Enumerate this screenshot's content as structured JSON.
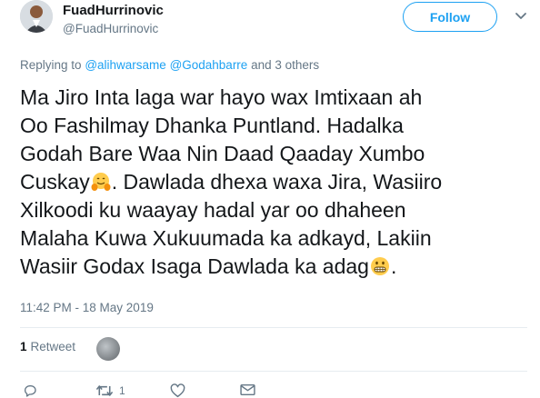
{
  "user": {
    "display_name": "FuadHurrinovic",
    "handle": "@FuadHurrinovic"
  },
  "follow_label": "Follow",
  "replying": {
    "prefix": "Replying to",
    "mention1": "@alihwarsame",
    "mention2": "@Godahbarre",
    "suffix": "and 3 others"
  },
  "tweet": {
    "line1": "Ma Jiro Inta laga war hayo wax Imtixaan ah",
    "line2": "Oo Fashilmay Dhanka Puntland. Hadalka",
    "line3": "Godah Bare Waa Nin Daad Qaaday Xumbo",
    "line4a": "Cuskay",
    "line4b": ". Dawlada dhexa waxa Jira, Wasiiro",
    "line5": "Xilkoodi ku waayay hadal yar oo dhaheen",
    "line6": "Malaha Kuwa Xukuumada ka adkayd, Lakiin",
    "line7a": "Wasiir Godax Isaga Dawlada ka adag",
    "line7b": ".",
    "emoji1": "hugging-face",
    "emoji2": "grimacing-face"
  },
  "timestamp": "11:42 PM - 18 May 2019",
  "stats": {
    "retweet_count": "1",
    "retweet_label": "Retweet"
  },
  "actions": {
    "reply_icon": "reply-icon",
    "retweet_icon": "retweet-icon",
    "retweet_count": "1",
    "like_icon": "heart-icon",
    "message_icon": "envelope-icon"
  },
  "colors": {
    "accent": "#1da1f2",
    "secondary_text": "#657786",
    "primary_text": "#14171a",
    "divider": "#e6ecf0"
  }
}
